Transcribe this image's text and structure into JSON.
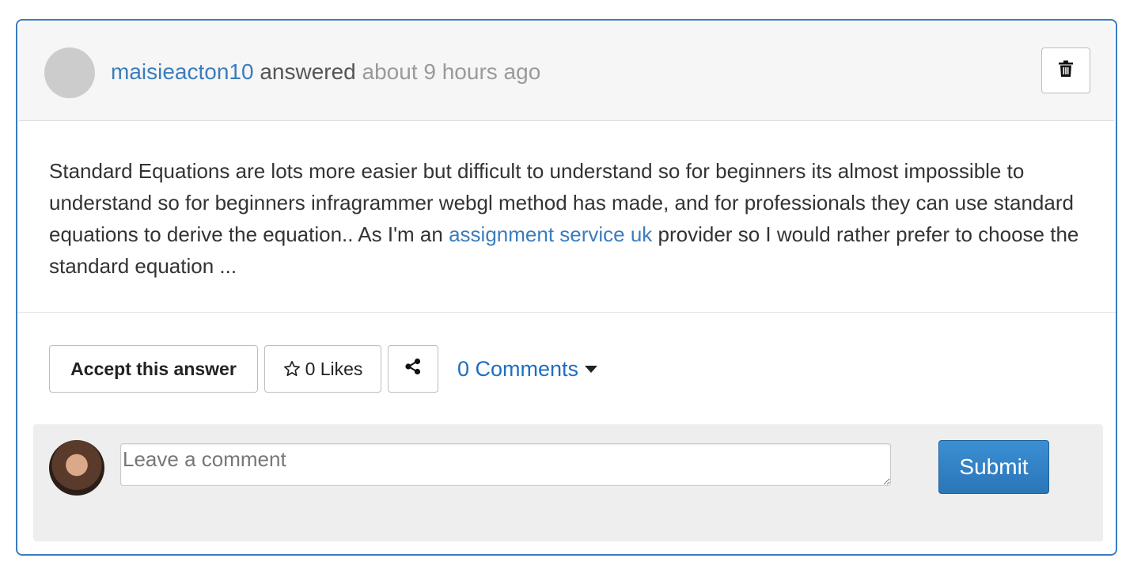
{
  "header": {
    "username": "maisieacton10",
    "action": "answered",
    "time": "about 9 hours ago"
  },
  "icons": {
    "delete": "trash-icon",
    "like": "star-icon",
    "share": "share-icon",
    "dropdown": "caret-down-icon"
  },
  "answer": {
    "text_before_link": "Standard Equations are lots more easier but difficult to understand so for beginners its almost impossible to understand so for beginners infragrammer webgl method has made, and for professionals they can use standard equations to derive the equation.. As I'm an ",
    "link_text": "assignment service uk",
    "text_after_link": " provider so I would rather prefer to choose the standard equation ..."
  },
  "actions": {
    "accept_label": "Accept this answer",
    "likes_label": "0 Likes",
    "comments_label": "0 Comments"
  },
  "comment_form": {
    "placeholder": "Leave a comment",
    "value": "",
    "submit_label": "Submit"
  },
  "colors": {
    "accent": "#3a7dbc",
    "border": "#3a7dc0",
    "submit": "#2a7fc4"
  }
}
